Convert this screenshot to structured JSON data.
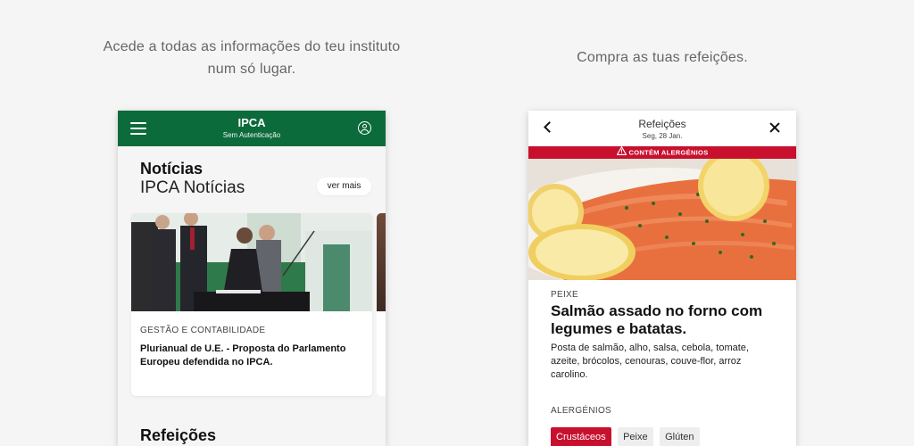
{
  "captions": {
    "left": "Acede a todas as informações do teu instituto num só lugar.",
    "right": "Compra as tuas refeições."
  },
  "left_phone": {
    "appbar": {
      "title": "IPCA",
      "subtitle": "Sem Autenticação",
      "menu_icon": "menu-icon",
      "profile_icon": "user-circle-icon"
    },
    "news_section": {
      "heading": "Notícias",
      "subheading": "IPCA Notícias",
      "more_label": "ver mais"
    },
    "news_card": {
      "category": "GESTÃO E CONTABILIDADE",
      "title": "Plurianual de U.E. - Proposta do Parlamento Europeu defendida no IPCA."
    },
    "meals_heading": "Refeições"
  },
  "right_phone": {
    "header": {
      "title": "Refeições",
      "date": "Seg, 28 Jan.",
      "back_icon": "chevron-left-icon",
      "close_icon": "close-icon"
    },
    "alert": "CONTÉM ALERGÉNIOS",
    "dish": {
      "type": "PEIXE",
      "name": "Salmão assado no forno com legumes e batatas.",
      "description": "Posta de salmão, alho, salsa, cebola, tomate, azeite, brócolos, cenouras, couve-flor, arroz carolino."
    },
    "allergens": {
      "heading": "ALERGÉNIOS",
      "items": [
        {
          "label": "Crustáceos",
          "active": true
        },
        {
          "label": "Peixe",
          "active": false
        },
        {
          "label": "Glúten",
          "active": false
        }
      ]
    }
  },
  "colors": {
    "brand_green": "#0b6b3a",
    "alert_red": "#c8102e"
  }
}
